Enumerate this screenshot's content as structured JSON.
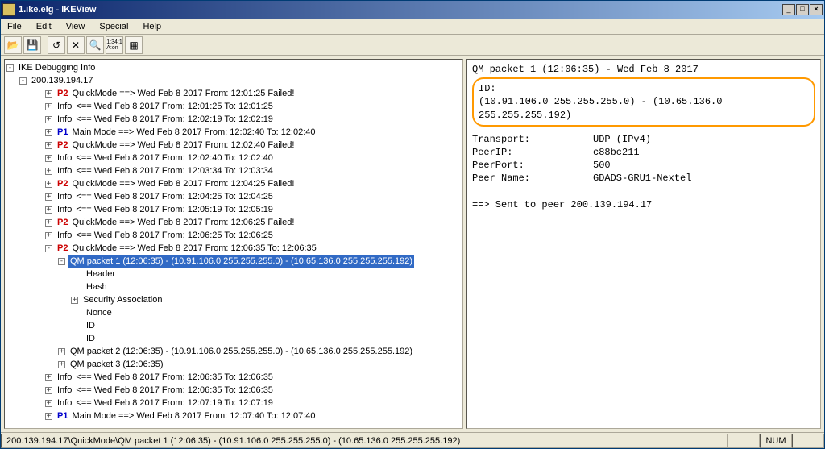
{
  "window": {
    "title": "1.ike.elg - IKEView"
  },
  "menu": {
    "file": "File",
    "edit": "Edit",
    "view": "View",
    "special": "Special",
    "help": "Help"
  },
  "toolbar_icons": {
    "open": "open-icon",
    "save": "save-icon",
    "undo": "undo-icon",
    "delete": "delete-icon",
    "search": "search-icon",
    "opt": "options-icon",
    "new": "new-icon"
  },
  "tree": {
    "root": "IKE Debugging Info",
    "host": "200.139.194.17",
    "rows": [
      {
        "indent": 2,
        "t": "+",
        "phase": "P2",
        "label": "QuickMode",
        "text": "  ==>  Wed Feb 8 2017 From: 12:01:25 Failed!"
      },
      {
        "indent": 2,
        "t": "+",
        "phase": "",
        "label": "Info",
        "text": "  <==  Wed Feb 8 2017 From: 12:01:25 To: 12:01:25"
      },
      {
        "indent": 2,
        "t": "+",
        "phase": "",
        "label": "Info",
        "text": "  <==  Wed Feb 8 2017 From: 12:02:19 To: 12:02:19"
      },
      {
        "indent": 2,
        "t": "+",
        "phase": "P1",
        "label": "Main Mode",
        "text": "  ==>  Wed Feb 8 2017 From: 12:02:40 To: 12:02:40"
      },
      {
        "indent": 2,
        "t": "+",
        "phase": "P2",
        "label": "QuickMode",
        "text": "  ==>  Wed Feb 8 2017 From: 12:02:40 Failed!"
      },
      {
        "indent": 2,
        "t": "+",
        "phase": "",
        "label": "Info",
        "text": "  <==  Wed Feb 8 2017 From: 12:02:40 To: 12:02:40"
      },
      {
        "indent": 2,
        "t": "+",
        "phase": "",
        "label": "Info",
        "text": "  <==  Wed Feb 8 2017 From: 12:03:34 To: 12:03:34"
      },
      {
        "indent": 2,
        "t": "+",
        "phase": "P2",
        "label": "QuickMode",
        "text": "  ==>  Wed Feb 8 2017 From: 12:04:25 Failed!"
      },
      {
        "indent": 2,
        "t": "+",
        "phase": "",
        "label": "Info",
        "text": "  <==  Wed Feb 8 2017 From: 12:04:25 To: 12:04:25"
      },
      {
        "indent": 2,
        "t": "+",
        "phase": "",
        "label": "Info",
        "text": "  <==  Wed Feb 8 2017 From: 12:05:19 To: 12:05:19"
      },
      {
        "indent": 2,
        "t": "+",
        "phase": "P2",
        "label": "QuickMode",
        "text": "  ==>  Wed Feb 8 2017 From: 12:06:25 Failed!"
      },
      {
        "indent": 2,
        "t": "+",
        "phase": "",
        "label": "Info",
        "text": "  <==  Wed Feb 8 2017 From: 12:06:25 To: 12:06:25"
      },
      {
        "indent": 2,
        "t": "-",
        "phase": "P2",
        "label": "QuickMode",
        "text": "  ==>  Wed Feb 8 2017 From: 12:06:35 To: 12:06:35"
      },
      {
        "indent": 3,
        "t": "-",
        "phase": "",
        "label": "",
        "text": "QM packet 1 (12:06:35) - (10.91.106.0  255.255.255.0) - (10.65.136.0  255.255.255.192)",
        "selected": true
      },
      {
        "indent": 4,
        "t": " ",
        "phase": "",
        "label": "",
        "text": "Header"
      },
      {
        "indent": 4,
        "t": " ",
        "phase": "",
        "label": "",
        "text": "Hash"
      },
      {
        "indent": 4,
        "t": "+",
        "phase": "",
        "label": "",
        "text": "Security Association"
      },
      {
        "indent": 4,
        "t": " ",
        "phase": "",
        "label": "",
        "text": "Nonce"
      },
      {
        "indent": 4,
        "t": " ",
        "phase": "",
        "label": "",
        "text": "ID"
      },
      {
        "indent": 4,
        "t": " ",
        "phase": "",
        "label": "",
        "text": "ID"
      },
      {
        "indent": 3,
        "t": "+",
        "phase": "",
        "label": "",
        "text": "QM packet 2 (12:06:35) - (10.91.106.0  255.255.255.0) - (10.65.136.0  255.255.255.192)"
      },
      {
        "indent": 3,
        "t": "+",
        "phase": "",
        "label": "",
        "text": "QM packet 3 (12:06:35)"
      },
      {
        "indent": 2,
        "t": "+",
        "phase": "",
        "label": "Info",
        "text": "  <==  Wed Feb 8 2017 From: 12:06:35 To: 12:06:35"
      },
      {
        "indent": 2,
        "t": "+",
        "phase": "",
        "label": "Info",
        "text": "  <==  Wed Feb 8 2017 From: 12:06:35 To: 12:06:35"
      },
      {
        "indent": 2,
        "t": "+",
        "phase": "",
        "label": "Info",
        "text": "  <==  Wed Feb 8 2017 From: 12:07:19 To: 12:07:19"
      },
      {
        "indent": 2,
        "t": "+",
        "phase": "P1",
        "label": "Main Mode",
        "text": "  ==>  Wed Feb 8 2017 From: 12:07:40 To: 12:07:40"
      }
    ]
  },
  "detail": {
    "header": "QM packet 1 (12:06:35) -  Wed Feb 8 2017",
    "id_label": "ID:",
    "id_value": "(10.91.106.0  255.255.255.0) - (10.65.136.0  255.255.255.192)",
    "transport_label": "Transport:",
    "transport_value": "UDP (IPv4)",
    "peerip_label": "PeerIP:",
    "peerip_value": "c88bc211",
    "peerport_label": "PeerPort:",
    "peerport_value": "500",
    "peername_label": "Peer Name:",
    "peername_value": "GDADS-GRU1-Nextel",
    "sent": "==> Sent to peer 200.139.194.17"
  },
  "status": {
    "path": "200.139.194.17\\QuickMode\\QM packet 1 (12:06:35) - (10.91.106.0  255.255.255.0) - (10.65.136.0  255.255.255.192)",
    "num": "NUM"
  }
}
